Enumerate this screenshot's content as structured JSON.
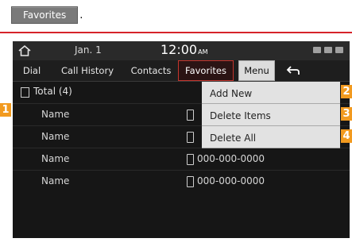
{
  "header_chip": {
    "label": "Favorites",
    "suffix": "."
  },
  "status": {
    "date": "Jan.  1",
    "time": "12:00",
    "ampm": "AM"
  },
  "tabs": [
    {
      "label": "Dial"
    },
    {
      "label": "Call History"
    },
    {
      "label": "Contacts"
    },
    {
      "label": "Favorites"
    },
    {
      "label": "Menu"
    }
  ],
  "list": {
    "total_label": "Total (4)",
    "rows": [
      {
        "name": "Name",
        "number": ""
      },
      {
        "name": "Name",
        "number": ""
      },
      {
        "name": "Name",
        "number": "000-000-0000"
      },
      {
        "name": "Name",
        "number": "000-000-0000"
      }
    ]
  },
  "menu_items": [
    {
      "label": "Add New"
    },
    {
      "label": "Delete Items"
    },
    {
      "label": "Delete All"
    }
  ],
  "callouts": [
    "1",
    "2",
    "3",
    "4"
  ],
  "colors": {
    "accent_red": "#d6232a",
    "callout_orange": "#f29a1f",
    "screen_bg": "#161616"
  }
}
